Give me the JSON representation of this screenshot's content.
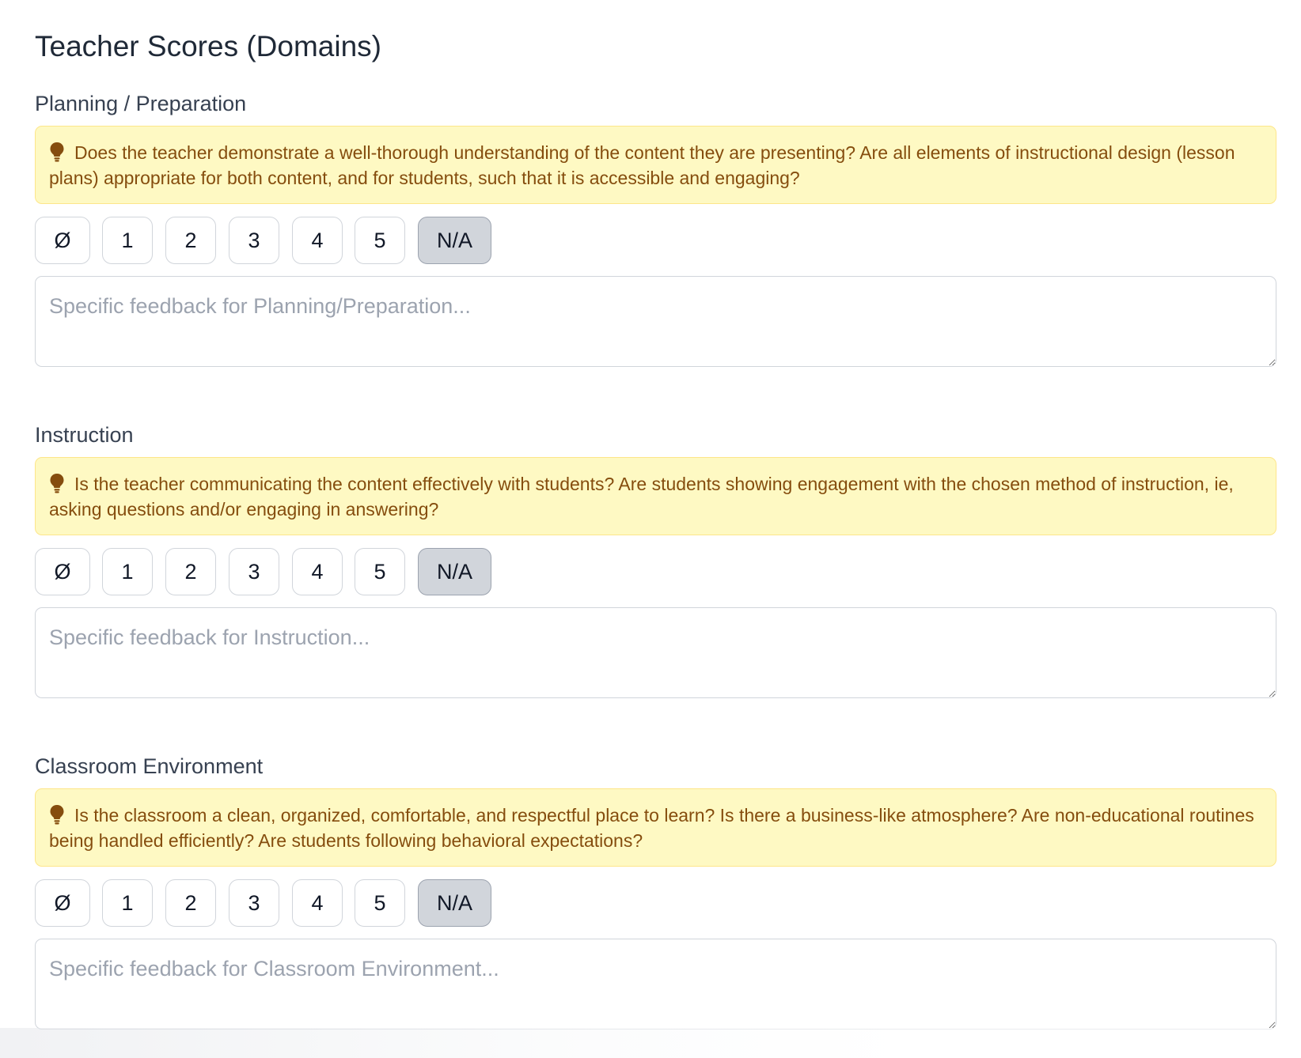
{
  "page": {
    "title": "Teacher Scores (Domains)"
  },
  "icons": {
    "hint": "lightbulb-icon"
  },
  "colors": {
    "hint_background": "#fef9c3",
    "hint_text": "#854d0e",
    "selected_button": "#d1d5db"
  },
  "score_options": [
    "Ø",
    "1",
    "2",
    "3",
    "4",
    "5",
    "N/A"
  ],
  "domains": [
    {
      "label": "Planning / Preparation",
      "hint": "Does the teacher demonstrate a well-thorough understanding of the content they are presenting? Are all elements of instructional design (lesson plans) appropriate for both content, and for students, such that it is accessible and engaging?",
      "selected": "N/A",
      "feedback_value": "",
      "feedback_placeholder": "Specific feedback for Planning/Preparation..."
    },
    {
      "label": "Instruction",
      "hint": "Is the teacher communicating the content effectively with students? Are students showing engagement with the chosen method of instruction, ie, asking questions and/or engaging in answering?",
      "selected": "N/A",
      "feedback_value": "",
      "feedback_placeholder": "Specific feedback for Instruction..."
    },
    {
      "label": "Classroom Environment",
      "hint": "Is the classroom a clean, organized, comfortable, and respectful place to learn? Is there a business-like atmosphere? Are non-educational routines being handled efficiently? Are students following behavioral expectations?",
      "selected": "N/A",
      "feedback_value": "",
      "feedback_placeholder": "Specific feedback for Classroom Environment..."
    }
  ]
}
